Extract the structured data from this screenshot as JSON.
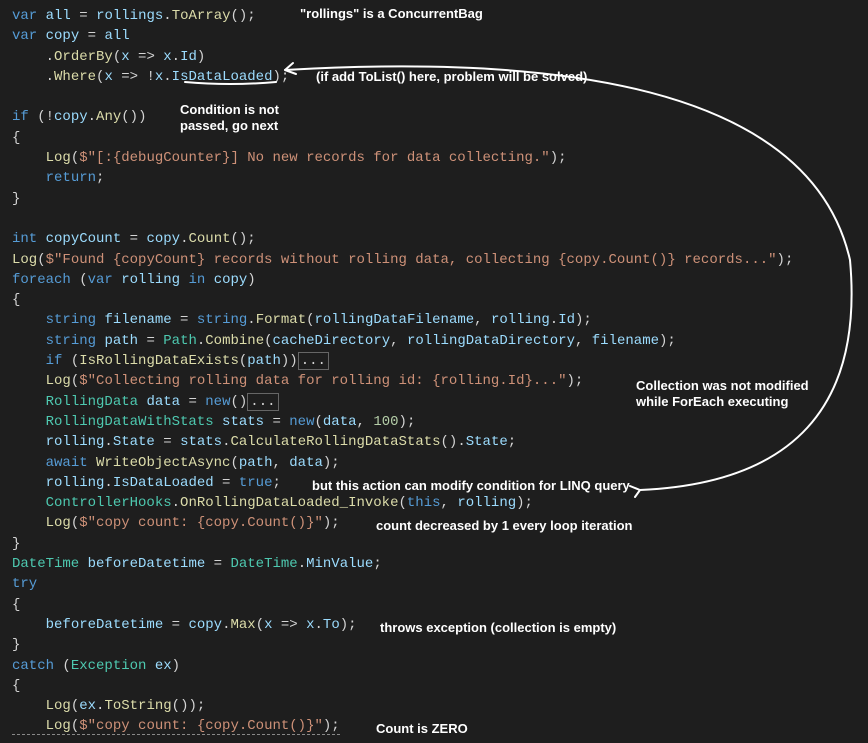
{
  "code": {
    "l1": {
      "kw_var": "var",
      "name": "all",
      "eq": " = ",
      "r": "rollings",
      "dot": ".",
      "m": "ToArray",
      "p": "();"
    },
    "l2": {
      "kw_var": "var",
      "name": "copy",
      "eq": " = ",
      "r": "all"
    },
    "l3": {
      "lead": "    .",
      "m": "OrderBy",
      "p1": "(",
      "x": "x",
      "arrow": " => ",
      "x2": "x",
      "dot": ".",
      "prop": "Id",
      "p2": ")"
    },
    "l4": {
      "lead": "    .",
      "m": "Where",
      "p1": "(",
      "x": "x",
      "arrow": " => !",
      "x2": "x",
      "dot": ".",
      "prop": "IsDataLoaded",
      "p2": ");"
    },
    "l6": {
      "kw_if": "if",
      "p1": " (!",
      "c": "copy",
      "dot": ".",
      "m": "Any",
      "p2": "())"
    },
    "l7": {
      "b": "{"
    },
    "l8": {
      "lead": "    ",
      "m": "Log",
      "p1": "(",
      "str": "$\"[:{debugCounter}] No new records for data collecting.\"",
      "p2": ");"
    },
    "l9": {
      "lead": "    ",
      "kw": "return",
      "p": ";"
    },
    "l10": {
      "b": "}"
    },
    "l12": {
      "kw": "int",
      "name": "copyCount",
      "eq": " = ",
      "c": "copy",
      "dot": ".",
      "m": "Count",
      "p": "();"
    },
    "l13": {
      "m": "Log",
      "p1": "(",
      "str": "$\"Found {copyCount} records without rolling data, collecting {copy.Count()} records...\"",
      "p2": ");"
    },
    "l14": {
      "kw": "foreach",
      "p1": " (",
      "kw2": "var",
      "name": "rolling",
      "kw3": "in",
      "c": "copy",
      "p2": ")"
    },
    "l15": {
      "b": "{"
    },
    "l16": {
      "lead": "    ",
      "t": "string",
      "name": "filename",
      "eq": " = ",
      "t2": "string",
      "dot": ".",
      "m": "Format",
      "p1": "(",
      "a1": "rollingDataFilename",
      "c": ", ",
      "a2": "rolling",
      "dot2": ".",
      "prop": "Id",
      "p2": ");"
    },
    "l17": {
      "lead": "    ",
      "t": "string",
      "name": "path",
      "eq": " = ",
      "t2": "Path",
      "dot": ".",
      "m": "Combine",
      "p1": "(",
      "a1": "cacheDirectory",
      "c1": ", ",
      "a2": "rollingDataDirectory",
      "c2": ", ",
      "a3": "filename",
      "p2": ");"
    },
    "l18": {
      "lead": "    ",
      "kw": "if",
      "p1": " (",
      "m": "IsRollingDataExists",
      "p2": "(",
      "a": "path",
      "p3": "))",
      "box": "..."
    },
    "l19": {
      "lead": "    ",
      "m": "Log",
      "p1": "(",
      "str": "$\"Collecting rolling data for rolling id: {rolling.Id}...\"",
      "p2": ");"
    },
    "l20": {
      "lead": "    ",
      "t": "RollingData",
      "name": "data",
      "eq": " = ",
      "kw": "new",
      "p": "()",
      "box": "..."
    },
    "l21": {
      "lead": "    ",
      "t": "RollingDataWithStats",
      "name": "stats",
      "eq": " = ",
      "kw": "new",
      "p1": "(",
      "a1": "data",
      "c": ", ",
      "n": "100",
      "p2": ");"
    },
    "l22": {
      "lead": "    ",
      "r": "rolling",
      "dot": ".",
      "prop": "State",
      "eq": " = ",
      "s": "stats",
      "dot2": ".",
      "m": "CalculateRollingDataStats",
      "p1": "().",
      "prop2": "State",
      "p2": ";"
    },
    "l23": {
      "lead": "    ",
      "kw": "await",
      "m": "WriteObjectAsync",
      "p1": "(",
      "a1": "path",
      "c": ", ",
      "a2": "data",
      "p2": ");"
    },
    "l24": {
      "lead": "    ",
      "r": "rolling",
      "dot": ".",
      "prop": "IsDataLoaded",
      "eq": " = ",
      "kw": "true",
      "p": ";"
    },
    "l25": {
      "lead": "    ",
      "t": "ControllerHooks",
      "dot": ".",
      "m": "OnRollingDataLoaded_Invoke",
      "p1": "(",
      "kw": "this",
      "c": ", ",
      "a": "rolling",
      "p2": ");"
    },
    "l26": {
      "lead": "    ",
      "m": "Log",
      "p1": "(",
      "str": "$\"copy count: {copy.Count()}\"",
      "p2": ");"
    },
    "l27": {
      "b": "}"
    },
    "l28": {
      "t": "DateTime",
      "name": "beforeDatetime",
      "eq": " = ",
      "t2": "DateTime",
      "dot": ".",
      "prop": "MinValue",
      "p": ";"
    },
    "l29": {
      "kw": "try"
    },
    "l30": {
      "b": "{"
    },
    "l31": {
      "lead": "    ",
      "n": "beforeDatetime",
      "eq": " = ",
      "c": "copy",
      "dot": ".",
      "m": "Max",
      "p1": "(",
      "x": "x",
      "arrow": " => ",
      "x2": "x",
      "dot2": ".",
      "prop": "To",
      "p2": ");"
    },
    "l32": {
      "b": "}"
    },
    "l33": {
      "kw": "catch",
      "p1": " (",
      "t": "Exception",
      "name": "ex",
      "p2": ")"
    },
    "l34": {
      "b": "{"
    },
    "l35": {
      "lead": "    ",
      "m": "Log",
      "p1": "(",
      "e": "ex",
      "dot": ".",
      "m2": "ToString",
      "p2": "());"
    },
    "l36": {
      "lead": "    ",
      "m": "Log",
      "p1": "(",
      "str": "$\"copy count: {copy.Count()}\"",
      "p2": ");"
    }
  },
  "annotations": {
    "a1": "\"rollings\" is a ConcurrentBag",
    "a2": "(if add ToList() here, problem will be solved)",
    "a3": "Condition is not\npassed, go next",
    "a4": "Collection was not modified\nwhile ForEach executing",
    "a5": "but this action can modify condition for LINQ query",
    "a6": "count decreased by 1 every loop iteration",
    "a7": "throws exception (collection is empty)",
    "a8": "Count is ZERO"
  }
}
